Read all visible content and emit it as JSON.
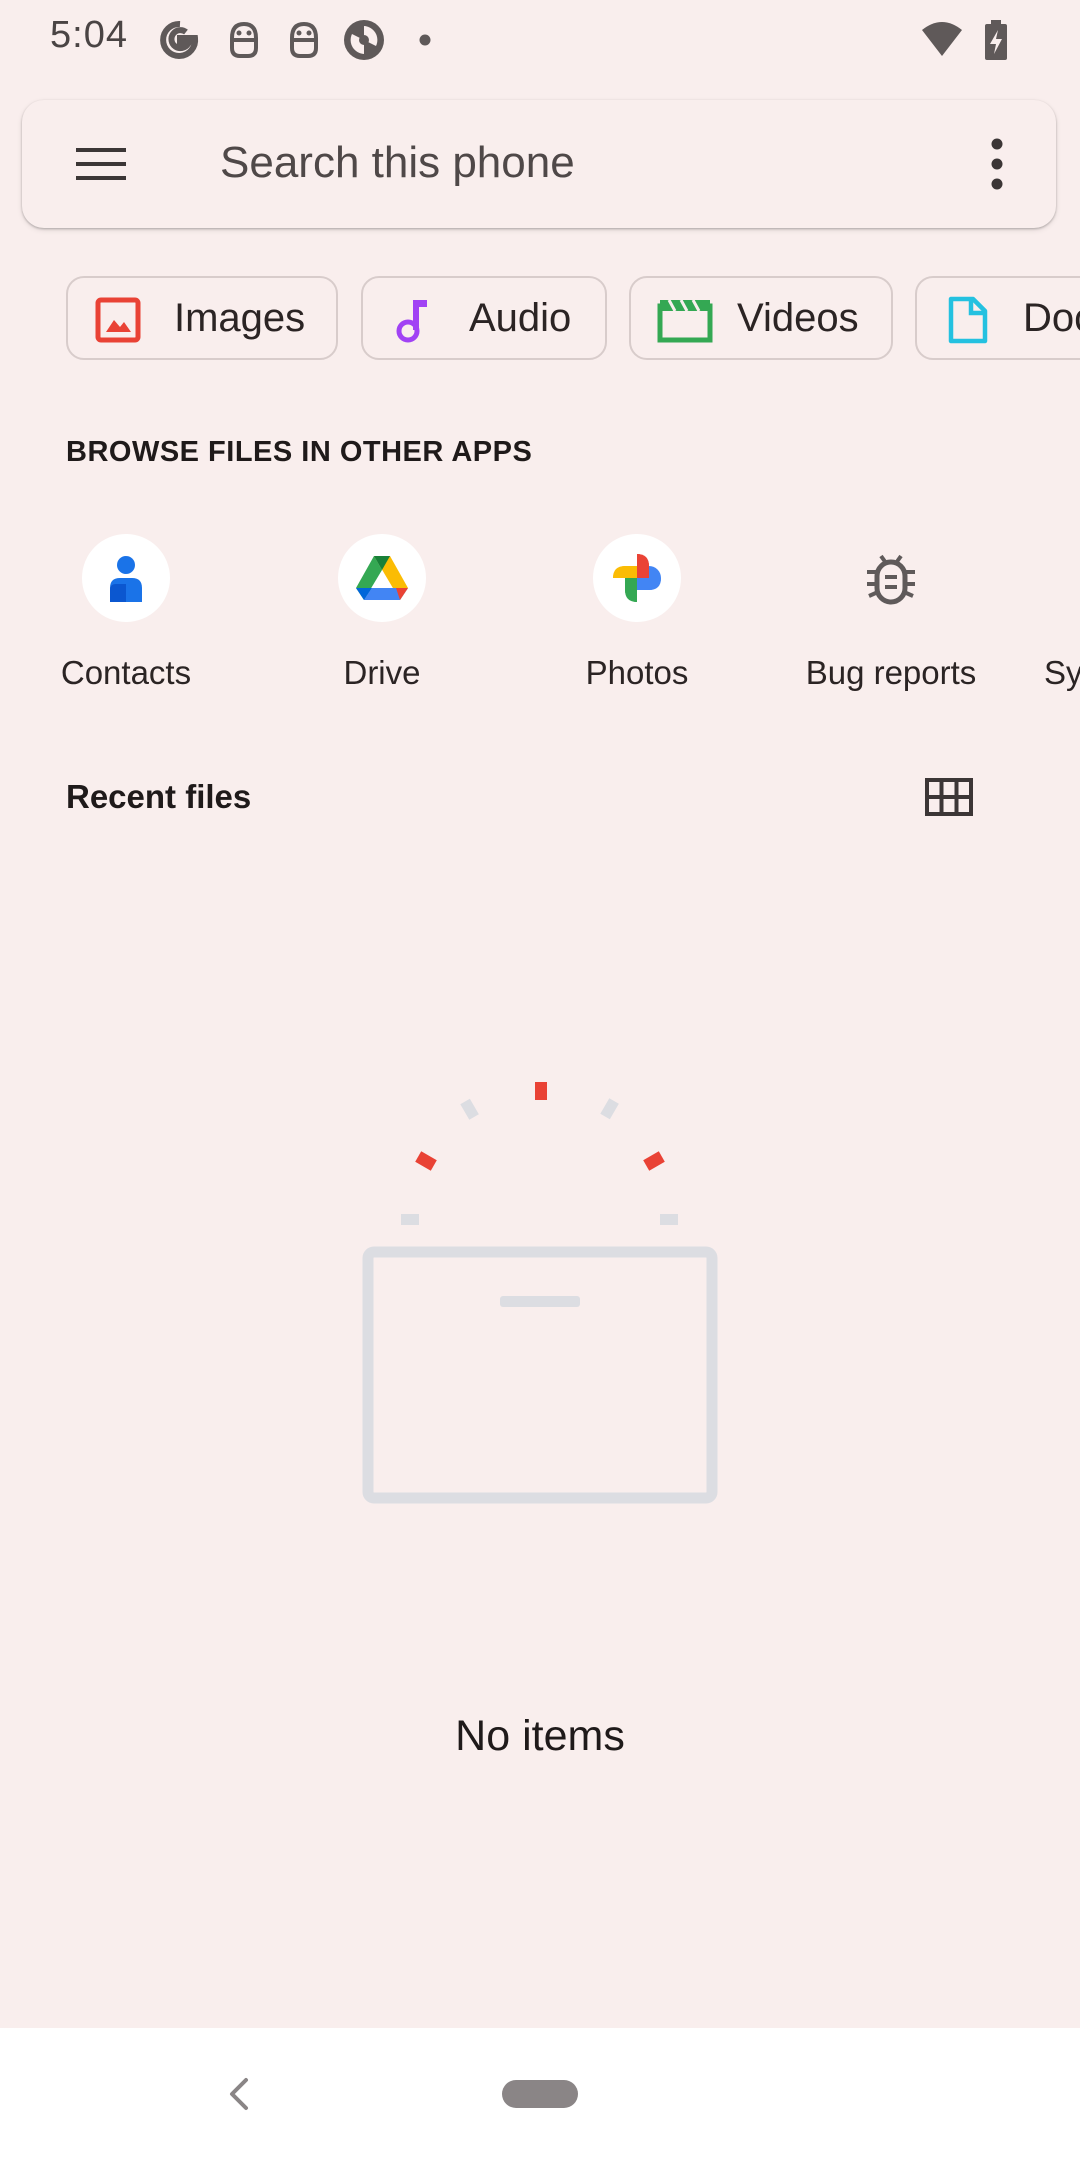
{
  "status_bar": {
    "time": "5:04"
  },
  "search": {
    "placeholder": "Search this phone"
  },
  "chips": {
    "images": "Images",
    "audio": "Audio",
    "videos": "Videos",
    "documents": "Documents"
  },
  "browse": {
    "header": "BROWSE FILES IN OTHER APPS",
    "apps": {
      "contacts": "Contacts",
      "drive": "Drive",
      "photos": "Photos",
      "bug_reports": "Bug reports",
      "system": "System"
    }
  },
  "recent": {
    "title": "Recent files",
    "empty_text": "No items"
  },
  "colors": {
    "background": "#f9eeed",
    "images_icon": "#e94235",
    "audio_icon": "#a142f4",
    "videos_icon": "#34a853",
    "documents_icon": "#24c1e0",
    "contacts_icon": "#1a73e8",
    "bug_icon": "#5f5a5a",
    "empty_accent": "#e94235",
    "empty_outline": "#dcdde2"
  },
  "icons": {
    "status": [
      "google-icon",
      "robot-icon",
      "robot-icon",
      "app-icon",
      "dot-icon",
      "wifi-icon",
      "battery-charging-icon"
    ],
    "menu": "hamburger-menu-icon",
    "overflow": "more-vert-icon",
    "grid_toggle": "grid-view-icon"
  }
}
